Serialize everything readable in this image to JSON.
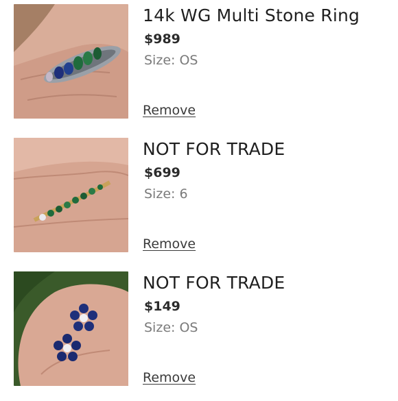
{
  "items": [
    {
      "title": "14k WG Multi Stone Ring",
      "price": "$989",
      "size_label": "Size:",
      "size_value": "OS",
      "remove_label": "Remove",
      "image": "ring-multi-stone-photo"
    },
    {
      "title": "NOT FOR TRADE",
      "price": "$699",
      "size_label": "Size:",
      "size_value": "6",
      "remove_label": "Remove",
      "image": "ring-emerald-band-photo"
    },
    {
      "title": "NOT FOR TRADE",
      "price": "$149",
      "size_label": "Size:",
      "size_value": "OS",
      "remove_label": "Remove",
      "image": "sapphire-flower-earrings-photo"
    }
  ],
  "colors": {
    "skin": "#d8a894",
    "sapphire": "#1e2f7a",
    "emerald": "#1f6b3c",
    "gold": "#c9a25a"
  }
}
